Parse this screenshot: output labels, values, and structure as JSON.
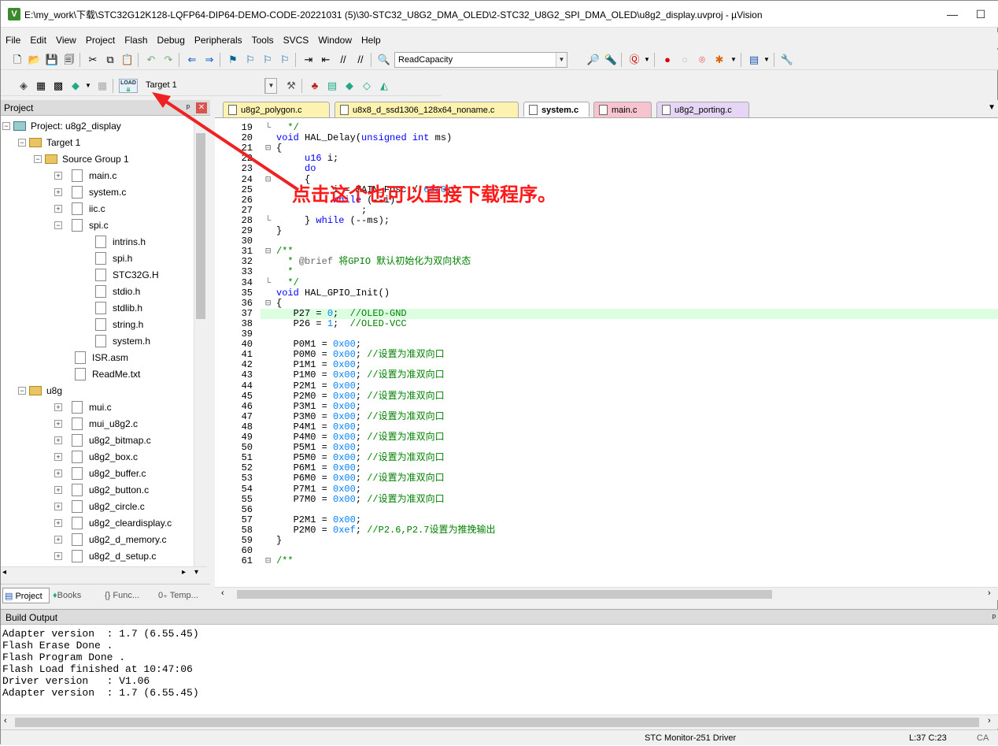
{
  "window": {
    "title": "E:\\my_work\\下载\\STC32G12K128-LQFP64-DIP64-DEMO-CODE-20221031 (5)\\30-STC32_U8G2_DMA_OLED\\2-STC32_U8G2_SPI_DMA_OLED\\u8g2_display.uvproj - µVision",
    "app_icon": "V",
    "minimize_glyph": "—",
    "maximize_glyph": "☐"
  },
  "menu": [
    "File",
    "Edit",
    "View",
    "Project",
    "Flash",
    "Debug",
    "Peripherals",
    "Tools",
    "SVCS",
    "Window",
    "Help"
  ],
  "toolbar": {
    "find_combo_value": "ReadCapacity",
    "target_combo_value": "Target 1",
    "load_label": "LOAD"
  },
  "project_panel": {
    "title": "Project",
    "pin_glyph": "ᵖ",
    "close_glyph": "✕",
    "tree": [
      {
        "label": "Project: u8g2_display",
        "kind": "project",
        "expander": "−"
      },
      {
        "label": "Target 1",
        "kind": "target",
        "expander": "−"
      },
      {
        "label": "Source Group 1",
        "kind": "folder",
        "expander": "−"
      },
      {
        "label": "main.c",
        "kind": "file",
        "expander": "+"
      },
      {
        "label": "system.c",
        "kind": "file",
        "expander": "+"
      },
      {
        "label": "iic.c",
        "kind": "file",
        "expander": "+"
      },
      {
        "label": "spi.c",
        "kind": "file",
        "expander": "−"
      },
      {
        "label": "intrins.h",
        "kind": "header",
        "expander": ""
      },
      {
        "label": "spi.h",
        "kind": "header",
        "expander": ""
      },
      {
        "label": "STC32G.H",
        "kind": "header",
        "expander": ""
      },
      {
        "label": "stdio.h",
        "kind": "header",
        "expander": ""
      },
      {
        "label": "stdlib.h",
        "kind": "header",
        "expander": ""
      },
      {
        "label": "string.h",
        "kind": "header",
        "expander": ""
      },
      {
        "label": "system.h",
        "kind": "header",
        "expander": ""
      },
      {
        "label": "ISR.asm",
        "kind": "file",
        "expander": ""
      },
      {
        "label": "ReadMe.txt",
        "kind": "file",
        "expander": ""
      },
      {
        "label": "u8g",
        "kind": "folder",
        "expander": "−"
      },
      {
        "label": "mui.c",
        "kind": "file",
        "expander": "+"
      },
      {
        "label": "mui_u8g2.c",
        "kind": "file",
        "expander": "+"
      },
      {
        "label": "u8g2_bitmap.c",
        "kind": "file",
        "expander": "+"
      },
      {
        "label": "u8g2_box.c",
        "kind": "file",
        "expander": "+"
      },
      {
        "label": "u8g2_buffer.c",
        "kind": "file",
        "expander": "+"
      },
      {
        "label": "u8g2_button.c",
        "kind": "file",
        "expander": "+"
      },
      {
        "label": "u8g2_circle.c",
        "kind": "file",
        "expander": "+"
      },
      {
        "label": "u8g2_cleardisplay.c",
        "kind": "file",
        "expander": "+"
      },
      {
        "label": "u8g2_d_memory.c",
        "kind": "file",
        "expander": "+"
      },
      {
        "label": "u8g2_d_setup.c",
        "kind": "file",
        "expander": "+"
      }
    ],
    "tabs": [
      "Project",
      "Books",
      "{} Func...",
      "0₊ Temp..."
    ]
  },
  "editor": {
    "tabs": [
      {
        "label": "u8g2_polygon.c",
        "color": "#fdf3b0",
        "active": false
      },
      {
        "label": "u8x8_d_ssd1306_128x64_noname.c",
        "color": "#fdf3b0",
        "active": false
      },
      {
        "label": "system.c",
        "color": "#ffffff",
        "active": true
      },
      {
        "label": "main.c",
        "color": "#f6c3cf",
        "active": false
      },
      {
        "label": "u8g2_porting.c",
        "color": "#e6d6f5",
        "active": false
      }
    ],
    "overflow_glyph": "▼",
    "lines": [
      {
        "n": "19",
        "fold": "└",
        "code": "  */"
      },
      {
        "n": "20",
        "fold": "",
        "code": "void HAL_Delay(unsigned int ms)"
      },
      {
        "n": "21",
        "fold": "⊟",
        "code": "{"
      },
      {
        "n": "22",
        "fold": "",
        "code": "     u16 i;"
      },
      {
        "n": "23",
        "fold": "",
        "code": "     do"
      },
      {
        "n": "24",
        "fold": "⊟",
        "code": "     {"
      },
      {
        "n": "25",
        "fold": "",
        "code": "          i = MAIN_Fosc / 6000;"
      },
      {
        "n": "26",
        "fold": "",
        "code": "          while (--i)"
      },
      {
        "n": "27",
        "fold": "",
        "code": "               ;"
      },
      {
        "n": "28",
        "fold": "└",
        "code": "     } while (--ms);"
      },
      {
        "n": "29",
        "fold": "",
        "code": "}"
      },
      {
        "n": "30",
        "fold": "",
        "code": ""
      },
      {
        "n": "31",
        "fold": "⊟",
        "code": "/**"
      },
      {
        "n": "32",
        "fold": "",
        "code": "  * @brief 将GPIO 默认初始化为双向状态"
      },
      {
        "n": "33",
        "fold": "",
        "code": "  *"
      },
      {
        "n": "34",
        "fold": "└",
        "code": "  */"
      },
      {
        "n": "35",
        "fold": "",
        "code": "void HAL_GPIO_Init()"
      },
      {
        "n": "36",
        "fold": "⊟",
        "code": "{"
      },
      {
        "n": "37",
        "fold": "",
        "code": "   P27 = 0;  //OLED-GND"
      },
      {
        "n": "38",
        "fold": "",
        "code": "   P26 = 1;  //OLED-VCC"
      },
      {
        "n": "39",
        "fold": "",
        "code": ""
      },
      {
        "n": "40",
        "fold": "",
        "code": "   P0M1 = 0x00;"
      },
      {
        "n": "41",
        "fold": "",
        "code": "   P0M0 = 0x00; //设置为准双向口"
      },
      {
        "n": "42",
        "fold": "",
        "code": "   P1M1 = 0x00;"
      },
      {
        "n": "43",
        "fold": "",
        "code": "   P1M0 = 0x00; //设置为准双向口"
      },
      {
        "n": "44",
        "fold": "",
        "code": "   P2M1 = 0x00;"
      },
      {
        "n": "45",
        "fold": "",
        "code": "   P2M0 = 0x00; //设置为准双向口"
      },
      {
        "n": "46",
        "fold": "",
        "code": "   P3M1 = 0x00;"
      },
      {
        "n": "47",
        "fold": "",
        "code": "   P3M0 = 0x00; //设置为准双向口"
      },
      {
        "n": "48",
        "fold": "",
        "code": "   P4M1 = 0x00;"
      },
      {
        "n": "49",
        "fold": "",
        "code": "   P4M0 = 0x00; //设置为准双向口"
      },
      {
        "n": "50",
        "fold": "",
        "code": "   P5M1 = 0x00;"
      },
      {
        "n": "51",
        "fold": "",
        "code": "   P5M0 = 0x00; //设置为准双向口"
      },
      {
        "n": "52",
        "fold": "",
        "code": "   P6M1 = 0x00;"
      },
      {
        "n": "53",
        "fold": "",
        "code": "   P6M0 = 0x00; //设置为准双向口"
      },
      {
        "n": "54",
        "fold": "",
        "code": "   P7M1 = 0x00;"
      },
      {
        "n": "55",
        "fold": "",
        "code": "   P7M0 = 0x00; //设置为准双向口"
      },
      {
        "n": "56",
        "fold": "",
        "code": ""
      },
      {
        "n": "57",
        "fold": "",
        "code": "   P2M1 = 0x00;"
      },
      {
        "n": "58",
        "fold": "",
        "code": "   P2M0 = 0xef; //P2.6,P2.7设置为推挽输出"
      },
      {
        "n": "59",
        "fold": "",
        "code": "}"
      },
      {
        "n": "60",
        "fold": "",
        "code": ""
      },
      {
        "n": "61",
        "fold": "⊟",
        "code": "/**"
      }
    ],
    "highlighted_line": "37"
  },
  "annotation": {
    "text": "点击这个也可以直接下载程序。",
    "color": "#ff1a1a"
  },
  "build_output": {
    "title": "Build Output",
    "pin_glyph": "ᵖ",
    "lines": [
      "Adapter version  : 1.7 (6.55.45)",
      "Flash Erase Done .",
      "Flash Program Done .",
      "Flash Load finished at 10:47:06",
      "Driver version   : V1.06",
      "Adapter version  : 1.7 (6.55.45)"
    ]
  },
  "status": {
    "driver": "STC Monitor-251 Driver",
    "cursor": "L:37 C:23",
    "caps": "CA"
  },
  "colors": {
    "comment": "#008000",
    "keyword": "#0000ff",
    "number": "#0080ff",
    "line_highlight": "#dbffe0"
  }
}
